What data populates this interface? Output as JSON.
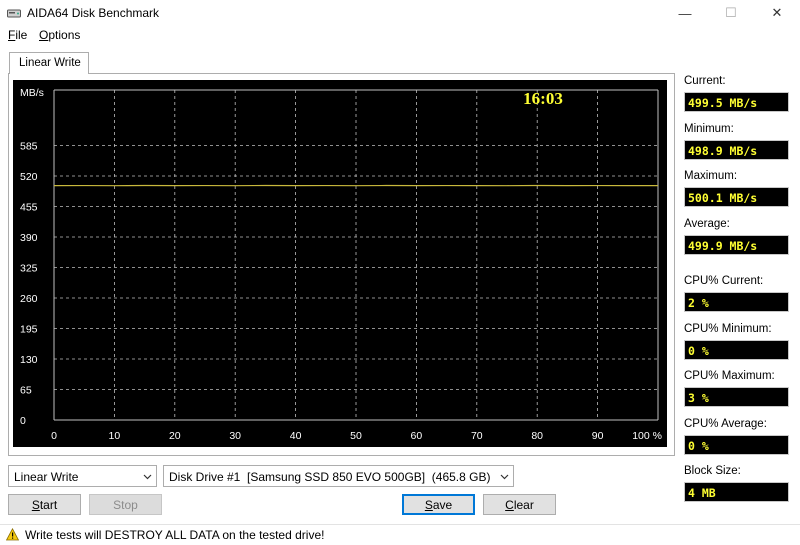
{
  "window": {
    "title": "AIDA64 Disk Benchmark",
    "minimize": "—",
    "maximize": "☐",
    "close": "✕"
  },
  "menu": {
    "file": "File",
    "options": "Options"
  },
  "tab": {
    "label": "Linear Write"
  },
  "chart_data": {
    "type": "line",
    "ylabel": "MB/s",
    "y_ticks": [
      "585",
      "520",
      "455",
      "390",
      "325",
      "260",
      "195",
      "130",
      "65",
      "0"
    ],
    "ylim": [
      0,
      650
    ],
    "x_ticks": [
      "0",
      "10",
      "20",
      "30",
      "40",
      "50",
      "60",
      "70",
      "80",
      "90",
      "100 %"
    ],
    "xlim": [
      0,
      100
    ],
    "grid": true,
    "clock": "16:03",
    "series": [
      {
        "color": "#c8b83c",
        "x": [
          0,
          5,
          10,
          15,
          20,
          25,
          30,
          35,
          40,
          45,
          50,
          55,
          60,
          65,
          70,
          75,
          80,
          85,
          90,
          95,
          100
        ],
        "y": [
          499.5,
          499.6,
          499.4,
          499.7,
          499.5,
          499.6,
          499.3,
          499.8,
          499.5,
          499.6,
          499.4,
          499.7,
          499.5,
          499.6,
          499.5,
          499.4,
          499.7,
          499.5,
          499.6,
          499.5,
          499.5
        ]
      }
    ]
  },
  "stats": {
    "current_label": "Current:",
    "current_value": "499.5 MB/s",
    "minimum_label": "Minimum:",
    "minimum_value": "498.9 MB/s",
    "maximum_label": "Maximum:",
    "maximum_value": "500.1 MB/s",
    "average_label": "Average:",
    "average_value": "499.9 MB/s",
    "cpu_current_label": "CPU% Current:",
    "cpu_current_value": "2 %",
    "cpu_minimum_label": "CPU% Minimum:",
    "cpu_minimum_value": "0 %",
    "cpu_maximum_label": "CPU% Maximum:",
    "cpu_maximum_value": "3 %",
    "cpu_average_label": "CPU% Average:",
    "cpu_average_value": "0 %",
    "block_size_label": "Block Size:",
    "block_size_value": "4 MB"
  },
  "controls": {
    "test_select": "Linear Write",
    "drive_select": "Disk Drive #1  [Samsung SSD 850 EVO 500GB]  (465.8 GB)",
    "start": "Start",
    "stop": "Stop",
    "save": "Save",
    "clear": "Clear"
  },
  "status": {
    "text": "Write tests will DESTROY ALL DATA on the tested drive!"
  },
  "colors": {
    "chart_bg": "#000000",
    "grid": "#bfbfbf",
    "axis_text": "#ffffff",
    "clock": "#ffff33",
    "value_text": "#ffff33"
  }
}
